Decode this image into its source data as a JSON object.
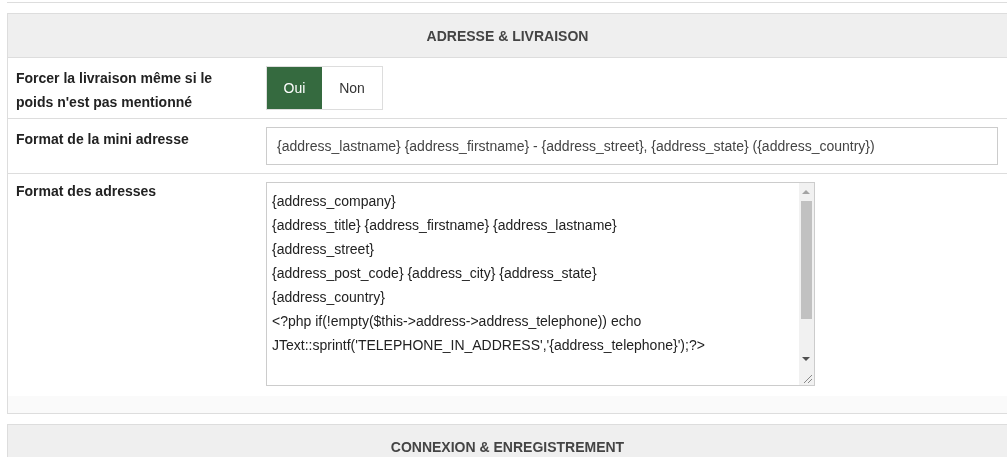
{
  "sections": [
    {
      "title": "ADRESSE & LIVRAISON",
      "rows": [
        {
          "kind": "toggle",
          "label": "Forcer la livraison même si le poids n'est pas mentionné",
          "options": [
            {
              "label": "Oui",
              "selected": true
            },
            {
              "label": "Non",
              "selected": false
            }
          ]
        },
        {
          "kind": "text",
          "label": "Format de la mini adresse",
          "value": "{address_lastname} {address_firstname} - {address_street}, {address_state} ({address_country})"
        },
        {
          "kind": "textarea",
          "label": "Format des adresses",
          "lines": [
            "{address_company}",
            "{address_title} {address_firstname} {address_lastname}",
            "{address_street}",
            "{address_post_code} {address_city} {address_state}",
            "{address_country}",
            "<?php if(!empty($this->address->address_telephone)) echo",
            "JText::sprintf('TELEPHONE_IN_ADDRESS','{address_telephone}');?>"
          ]
        }
      ]
    },
    {
      "title": "CONNEXION & ENREGISTREMENT"
    }
  ]
}
